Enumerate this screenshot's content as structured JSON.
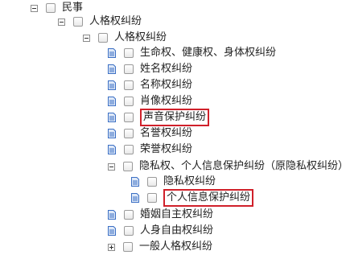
{
  "tree": {
    "minshi": "民事",
    "renge_quan": "人格权纠纷",
    "renge_quan_sub": "人格权纠纷",
    "items": [
      "生命权、健康权、身体权纠纷",
      "姓名权纠纷",
      "名称权纠纷",
      "肖像权纠纷",
      "声音保护纠纷",
      "名誉权纠纷",
      "荣誉权纠纷",
      "隐私权、个人信息保护纠纷（原隐私权纠纷）",
      "婚姻自主权纠纷",
      "人身自由权纠纷",
      "一般人格权纠纷"
    ],
    "privacy_children": [
      "隐私权纠纷",
      "个人信息保护纠纷"
    ]
  },
  "colors": {
    "highlight": "#d0202a",
    "doc_icon": "#3b6fc4"
  }
}
